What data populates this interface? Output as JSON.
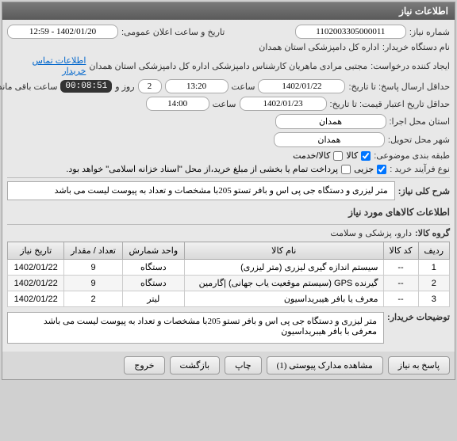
{
  "panel_title": "اطلاعات نیاز",
  "f": {
    "req_no_lbl": "شماره نیاز:",
    "req_no": "1102003305000011",
    "pub_date_lbl": "تاریخ و ساعت اعلان عمومی:",
    "pub_date": "1402/01/20 - 12:59",
    "buyer_device_lbl": "نام دستگاه خریدار:",
    "buyer_device": "اداره کل دامپزشکی استان همدان",
    "creator_lbl": "ایجاد کننده درخواست:",
    "creator": "مجتبی مرادی ماهریان کارشناس دامپزشکی اداره کل دامپزشکی استان همدان",
    "contact_link": "اطلاعات تماس خریدار",
    "deadline_lbl": "حداقل ارسال پاسخ: تا تاریخ:",
    "deadline_date": "1402/01/22",
    "time_lbl": "ساعت",
    "deadline_time": "13:20",
    "days": "2",
    "days_lbl": "روز و",
    "timer": "00:08:51",
    "remain_lbl": "ساعت باقی مانده",
    "valid_lbl": "حداقل تاریخ اعتبار قیمت: تا تاریخ:",
    "valid_date": "1402/01/23",
    "valid_time": "14:00",
    "exec_loc_lbl": "استان محل اجرا:",
    "exec_loc": "همدان",
    "deliver_loc_lbl": "شهر محل تحویل:",
    "deliver_loc": "همدان",
    "class_lbl": "طبقه بندی موضوعی:",
    "cb_goods": "کالا",
    "cb_services": "کالا/خدمت",
    "proc_lbl": "نوع فرآیند خرید :",
    "cb_partial": "جزیی",
    "proc_note": "پرداخت تمام یا بخشی از مبلغ خرید،از محل \"اسناد خزانه اسلامی\" خواهد بود.",
    "summary_lbl": "شرح کلی نیاز:",
    "summary": "متر لیزری و دستگاه جی پی اس و بافر تستو 205با مشخصات و تعداد به پیوست لیست می باشد",
    "items_title": "اطلاعات کالاهای مورد نیاز",
    "group_lbl": "گروه کالا:",
    "group": "دارو، پزشکی و سلامت",
    "desc_lbl": "توضیحات خریدار:",
    "desc": "متر لیزری و دستگاه جی پی اس و بافر تستو 205با مشخصات و تعداد به پیوست لیست می باشد\nمعرفی با بافر هیبریداسیون"
  },
  "th": {
    "row": "ردیف",
    "code": "کد کالا",
    "name": "نام کالا",
    "unit": "واحد شمارش",
    "qty": "تعداد / مقدار",
    "date": "تاریخ نیاز"
  },
  "rows": [
    {
      "n": "1",
      "code": "--",
      "name": "سیستم اندازه گیری لیزری (متر لیزری)",
      "unit": "دستگاه",
      "qty": "9",
      "date": "1402/01/22"
    },
    {
      "n": "2",
      "code": "--",
      "name": "گیرنده GPS (سیستم موقعیت یاب جهانی) |گارمین",
      "unit": "دستگاه",
      "qty": "9",
      "date": "1402/01/22"
    },
    {
      "n": "3",
      "code": "--",
      "name": "معرف یا بافر هیبریداسیون",
      "unit": "لیتر",
      "qty": "2",
      "date": "1402/01/22"
    }
  ],
  "btn": {
    "respond": "پاسخ به نیاز",
    "attach": "مشاهده مدارک پیوستی (1)",
    "print": "چاپ",
    "back": "بازگشت",
    "exit": "خروج"
  }
}
